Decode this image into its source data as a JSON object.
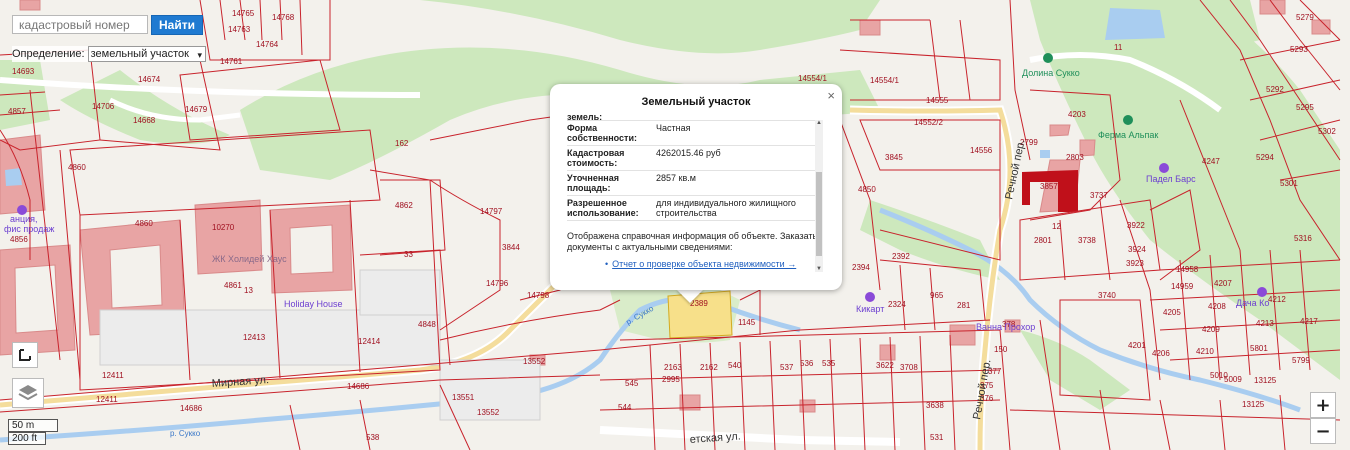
{
  "search": {
    "placeholder": "кадастровый номер",
    "value": "",
    "button_label": "Найти"
  },
  "definition": {
    "label": "Определение:",
    "selected": "земельный участок"
  },
  "popup": {
    "title": "Земельный участок",
    "cut_row": "земель:",
    "rows": [
      {
        "key": "Форма собственности:",
        "value": "Частная"
      },
      {
        "key": "Кадастровая стоимость:",
        "value": "4262015.46 руб"
      },
      {
        "key": "Уточненная площадь:",
        "value": "2857 кв.м"
      },
      {
        "key": "Разрешенное использование:",
        "value": "для индивидуального жилищного строительства"
      }
    ],
    "info": "Отображена справочная информация об объекте. Заказать документы с актуальными сведениями:",
    "link": "Отчет о проверке объекта недвижимости →",
    "close": "×"
  },
  "controls": {
    "zoom_in": "+",
    "zoom_out": "−",
    "scale_metric": "50 m",
    "scale_imperial": "200 ft"
  },
  "map": {
    "streets": [
      {
        "name": "Мирная ул."
      },
      {
        "name": "Речной пер."
      },
      {
        "name": "Речной пер."
      },
      {
        "name": "етская ул."
      }
    ],
    "rivers": [
      {
        "name": "р. Сукко"
      },
      {
        "name": "р. Сукко"
      }
    ],
    "pois": [
      {
        "name": "Долина Сукко"
      },
      {
        "name": "Ферма Альпак"
      },
      {
        "name": "Падел Барс"
      },
      {
        "name": "Кикарт"
      },
      {
        "name": "Ванна Прохор"
      },
      {
        "name": "Дача Ко"
      },
      {
        "name": "анция,"
      },
      {
        "name": "фис продаж"
      },
      {
        "name": "Holiday House"
      }
    ],
    "parks": [
      {
        "name": "ЖК Холидей Хаус"
      }
    ],
    "plots": [
      {
        "num": "14765"
      },
      {
        "num": "14768"
      },
      {
        "num": "14763"
      },
      {
        "num": "14764"
      },
      {
        "num": "14761"
      },
      {
        "num": "14693"
      },
      {
        "num": "14674"
      },
      {
        "num": "14706"
      },
      {
        "num": "14679"
      },
      {
        "num": "14668"
      },
      {
        "num": "4857"
      },
      {
        "num": "4860"
      },
      {
        "num": "4860"
      },
      {
        "num": "4856"
      },
      {
        "num": "4861"
      },
      {
        "num": "4862"
      },
      {
        "num": "14797"
      },
      {
        "num": "3844"
      },
      {
        "num": "33"
      },
      {
        "num": "14798"
      },
      {
        "num": "14796"
      },
      {
        "num": "162"
      },
      {
        "num": "10270"
      },
      {
        "num": "13"
      },
      {
        "num": "12413"
      },
      {
        "num": "12414"
      },
      {
        "num": "4848"
      },
      {
        "num": "12411"
      },
      {
        "num": "12411"
      },
      {
        "num": "14686"
      },
      {
        "num": "14686"
      },
      {
        "num": "13552"
      },
      {
        "num": "13552"
      },
      {
        "num": "13551"
      },
      {
        "num": "14554/1"
      },
      {
        "num": "14554/1"
      },
      {
        "num": "14555"
      },
      {
        "num": "14552/2"
      },
      {
        "num": "14556"
      },
      {
        "num": "3845"
      },
      {
        "num": "4850"
      },
      {
        "num": "4203"
      },
      {
        "num": "3857"
      },
      {
        "num": "3737"
      },
      {
        "num": "2801"
      },
      {
        "num": "3738"
      },
      {
        "num": "3922"
      },
      {
        "num": "3924"
      },
      {
        "num": "3923"
      },
      {
        "num": "3740"
      },
      {
        "num": "4247"
      },
      {
        "num": "5294"
      },
      {
        "num": "5301"
      },
      {
        "num": "5316"
      },
      {
        "num": "5279"
      },
      {
        "num": "5293"
      },
      {
        "num": "5292"
      },
      {
        "num": "5295"
      },
      {
        "num": "5302"
      },
      {
        "num": "11"
      },
      {
        "num": "14958"
      },
      {
        "num": "14959"
      },
      {
        "num": "4207"
      },
      {
        "num": "4205"
      },
      {
        "num": "4208"
      },
      {
        "num": "4209"
      },
      {
        "num": "4206"
      },
      {
        "num": "4210"
      },
      {
        "num": "4213"
      },
      {
        "num": "4217"
      },
      {
        "num": "4212"
      },
      {
        "num": "5801"
      },
      {
        "num": "5799"
      },
      {
        "num": "13125"
      },
      {
        "num": "13125"
      },
      {
        "num": "2389"
      },
      {
        "num": "2392"
      },
      {
        "num": "2324"
      },
      {
        "num": "965"
      },
      {
        "num": "281"
      },
      {
        "num": "2394"
      },
      {
        "num": "378"
      },
      {
        "num": "150"
      },
      {
        "num": "377"
      },
      {
        "num": "376"
      },
      {
        "num": "375"
      },
      {
        "num": "536"
      },
      {
        "num": "535"
      },
      {
        "num": "537"
      },
      {
        "num": "540"
      },
      {
        "num": "1145"
      },
      {
        "num": "2163"
      },
      {
        "num": "2162"
      },
      {
        "num": "3622"
      },
      {
        "num": "3708"
      },
      {
        "num": "3638"
      },
      {
        "num": "531"
      },
      {
        "num": "538"
      },
      {
        "num": "545"
      },
      {
        "num": "544"
      },
      {
        "num": "2995"
      },
      {
        "num": "4201"
      },
      {
        "num": "5010"
      },
      {
        "num": "5009"
      },
      {
        "num": "2803"
      },
      {
        "num": "2799"
      },
      {
        "num": "12"
      }
    ]
  }
}
